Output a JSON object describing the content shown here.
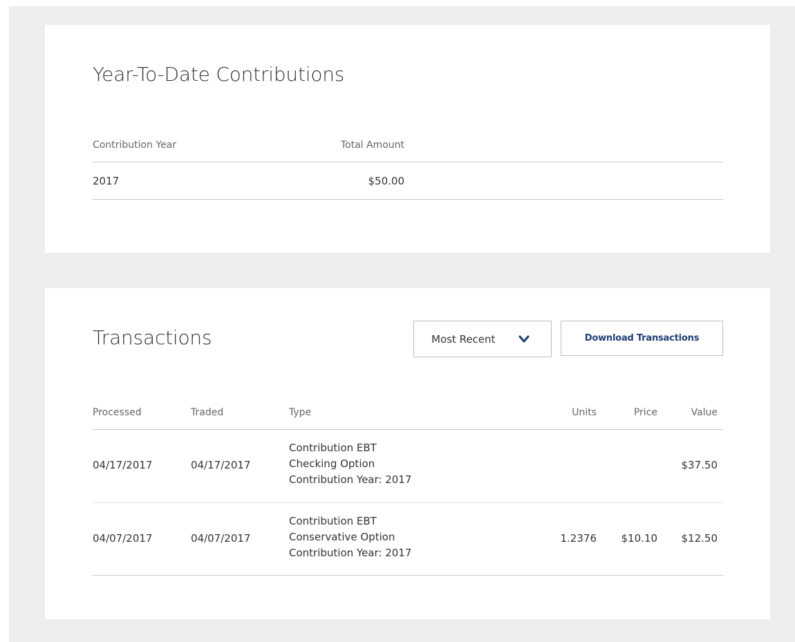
{
  "ytd": {
    "title": "Year-To-Date Contributions",
    "headers": {
      "year": "Contribution Year",
      "amount": "Total Amount"
    },
    "rows": [
      {
        "year": "2017",
        "amount": "$50.00"
      }
    ]
  },
  "transactions": {
    "title": "Transactions",
    "sort_label": "Most Recent",
    "download_label": "Download Transactions",
    "headers": {
      "processed": "Processed",
      "traded": "Traded",
      "type": "Type",
      "units": "Units",
      "price": "Price",
      "value": "Value"
    },
    "rows": [
      {
        "processed": "04/17/2017",
        "traded": "04/17/2017",
        "type_line1": "Contribution EBT",
        "type_line2": "Checking Option",
        "type_line3": "Contribution Year: 2017",
        "units": "",
        "price": "",
        "value": "$37.50"
      },
      {
        "processed": "04/07/2017",
        "traded": "04/07/2017",
        "type_line1": "Contribution EBT",
        "type_line2": "Conservative Option",
        "type_line3": "Contribution Year: 2017",
        "units": "1.2376",
        "price": "$10.10",
        "value": "$12.50"
      }
    ]
  },
  "icons": {
    "sort_chevron": "chevron-down-icon"
  },
  "colors": {
    "page_bg": "#eeeeee",
    "card_bg": "#ffffff",
    "accent": "#1e3f73"
  }
}
